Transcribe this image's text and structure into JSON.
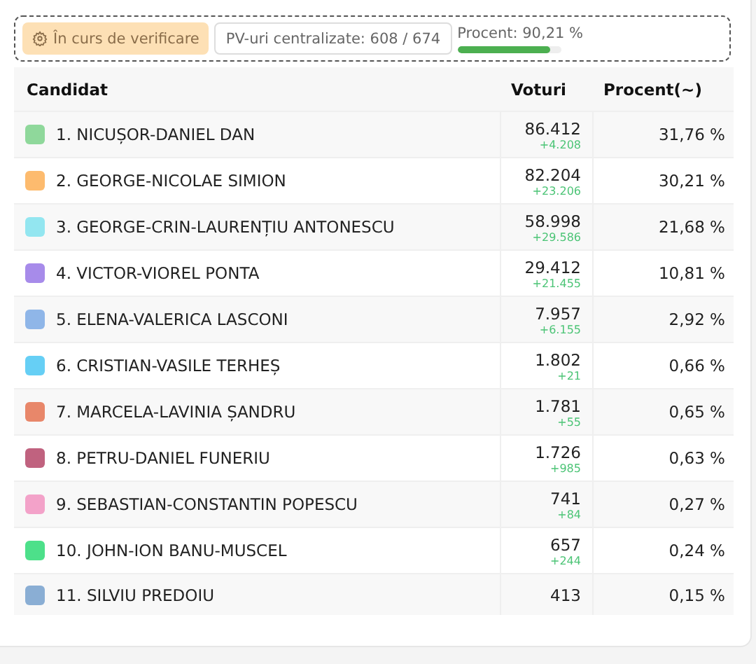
{
  "status": {
    "badge": "În curs de verificare",
    "counter": "PV-uri centralizate: 608 / 674",
    "progress_label": "Procent: 90,21 %",
    "level": 0.9
  },
  "table": {
    "columns": [
      "Candidat",
      "Voturi",
      "Procent(~)"
    ],
    "rows": [
      {
        "name": "1. NICUȘOR-DANIEL DAN",
        "color": "#8fd89b",
        "votes": "86.412",
        "delta": "+4.208",
        "percent": "31,76 %"
      },
      {
        "name": "2. GEORGE-NICOLAE SIMION",
        "color": "#fdbb6e",
        "votes": "82.204",
        "delta": "+23.206",
        "percent": "30,21 %"
      },
      {
        "name": "3. GEORGE-CRIN-LAURENȚIU ANTONESCU",
        "color": "#93e6f0",
        "votes": "58.998",
        "delta": "+29.586",
        "percent": "21,68 %"
      },
      {
        "name": "4. VICTOR-VIOREL PONTA",
        "color": "#a78bea",
        "votes": "29.412",
        "delta": "+21.455",
        "percent": "10,81 %"
      },
      {
        "name": "5. ELENA-VALERICA LASCONI",
        "color": "#8fb6e8",
        "votes": "7.957",
        "delta": "+6.155",
        "percent": "2,92 %"
      },
      {
        "name": "6. CRISTIAN-VASILE TERHEȘ",
        "color": "#66cff5",
        "votes": "1.802",
        "delta": "+21",
        "percent": "0,66 %"
      },
      {
        "name": "7. MARCELA-LAVINIA ȘANDRU",
        "color": "#e8876a",
        "votes": "1.781",
        "delta": "+55",
        "percent": "0,65 %"
      },
      {
        "name": "8. PETRU-DANIEL FUNERIU",
        "color": "#c0627f",
        "votes": "1.726",
        "delta": "+985",
        "percent": "0,63 %"
      },
      {
        "name": "9. SEBASTIAN-CONSTANTIN POPESCU",
        "color": "#f3a2c9",
        "votes": "741",
        "delta": "+84",
        "percent": "0,27 %"
      },
      {
        "name": "10. JOHN-ION BANU-MUSCEL",
        "color": "#4de08a",
        "votes": "657",
        "delta": "+244",
        "percent": "0,24 %"
      },
      {
        "name": "11. SILVIU PREDOIU",
        "color": "#8aaed4",
        "votes": "413",
        "percent": "0,15 %"
      }
    ]
  }
}
